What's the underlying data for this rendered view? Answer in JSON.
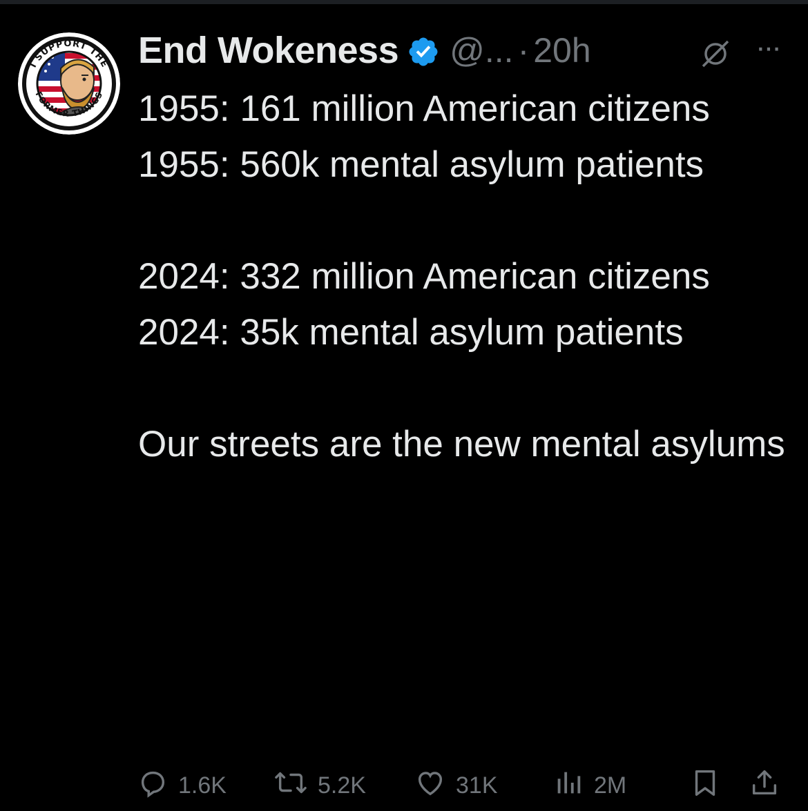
{
  "tweet": {
    "display_name": "End Wokeness",
    "handle": "@...",
    "separator": "·",
    "time": "20h",
    "verified_icon": "verified-badge-icon",
    "text": "1955: 161 million American citizens\n1955: 560k mental asylum patients\n\n2024: 332 million American citizens\n2024: 35k mental asylum patients\n\nOur streets are the new mental asylums",
    "avatar": {
      "top_text": "I SUPPORT THE",
      "bottom_text": "FORMER THINGS"
    }
  },
  "actions": {
    "replies": "1.6K",
    "retweets": "5.2K",
    "likes": "31K",
    "views": "2M"
  },
  "colors": {
    "background": "#000000",
    "text": "#e7e9ea",
    "muted": "#71767b",
    "verified": "#1d9bf0"
  }
}
